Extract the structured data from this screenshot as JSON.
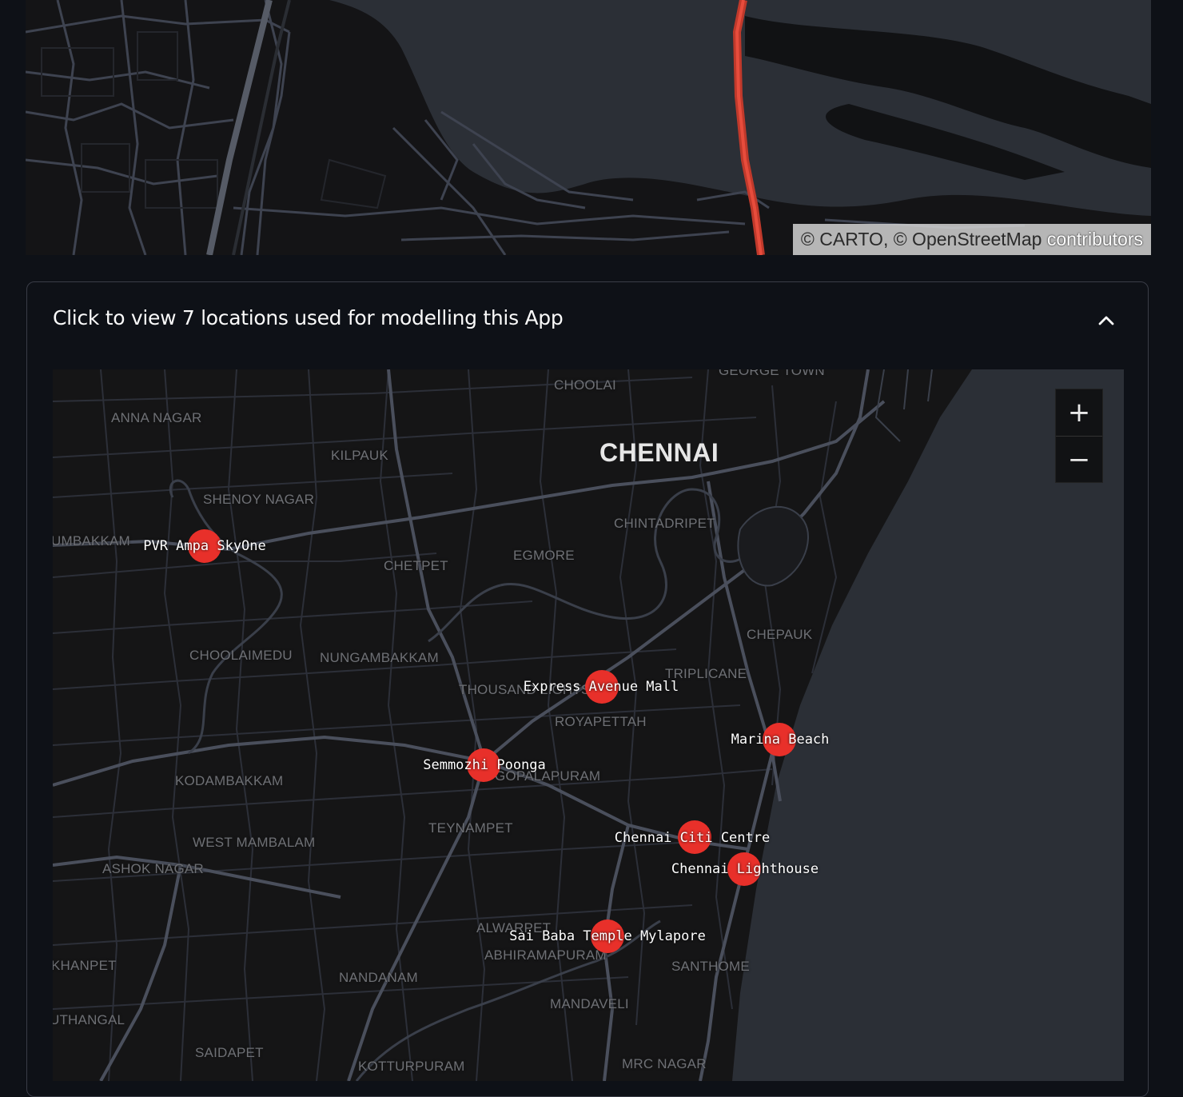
{
  "top_map": {
    "attribution": {
      "carto": "© CARTO",
      "separator": ", ",
      "osm": "© OpenStreetMap",
      "contributors": " contributors"
    }
  },
  "expander": {
    "title": "Click to view 7 locations used for modelling this App",
    "expanded": true,
    "chevron_icon": "chevron-up-icon"
  },
  "map": {
    "city": "CHENNAI",
    "zoom_in": "+",
    "zoom_out": "−",
    "areas": [
      "GEORGE TOWN",
      "CHOOLAI",
      "ANNA NAGAR",
      "KILPAUK",
      "SHENOY NAGAR",
      "UMBAKKAM",
      "CHINTADRIPET",
      "EGMORE",
      "CHETPET",
      "CHEPAUK",
      "CHOOLAIMEDU",
      "NUNGAMBAKKAM",
      "TRIPLICANE",
      "THOUSAND LIGHTS",
      "ROYAPETTAH",
      "KODAMBAKKAM",
      "GOPALAPURAM",
      "TEYNAMPET",
      "WEST MAMBALAM",
      "ASHOK NAGAR",
      "ALWARPET",
      "ABHIRAMAPURAM",
      "SANTHOME",
      "KHANPET",
      "NANDANAM",
      "MANDAVELI",
      "UTHANGAL",
      "SAIDAPET",
      "KOTTURPURAM",
      "MRC NAGAR"
    ],
    "locations": [
      "PVR Ampa SkyOne",
      "Express Avenue Mall",
      "Marina Beach",
      "Semmozhi Poonga",
      "Chennai Citi Centre",
      "Chennai Lighthouse",
      "Sai Baba Temple Mylapore"
    ],
    "marker_color": "#e8302a",
    "background_color": "#151516",
    "sea_color": "#2b2f36"
  }
}
